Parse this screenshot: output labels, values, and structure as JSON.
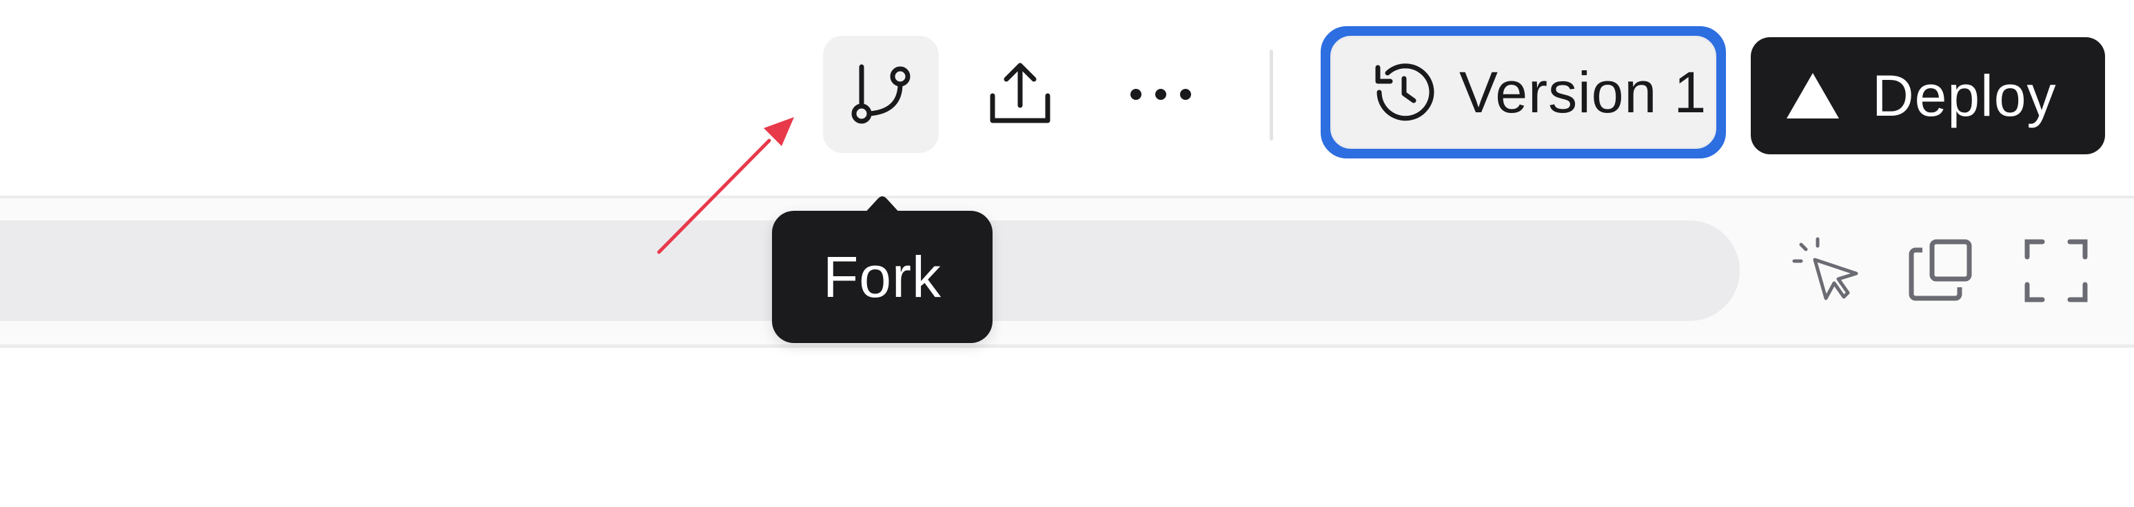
{
  "toolbar": {
    "fork_icon": "git-fork-icon",
    "share_icon": "upload-share-icon",
    "more_icon": "more-horizontal-icon",
    "version": {
      "icon": "history-clock-icon",
      "label": "Version 1"
    },
    "deploy": {
      "icon": "triangle-icon",
      "label": "Deploy"
    }
  },
  "tooltip": {
    "label": "Fork"
  },
  "subbar": {
    "select_icon": "cursor-select-icon",
    "popout_icon": "popout-window-icon",
    "fullscreen_icon": "fullscreen-icon"
  },
  "colors": {
    "focus_ring": "#2d6ee0",
    "dark_button": "#1b1b1d",
    "annotation": "#e8394a",
    "hover_bg": "#f1f1f2"
  }
}
